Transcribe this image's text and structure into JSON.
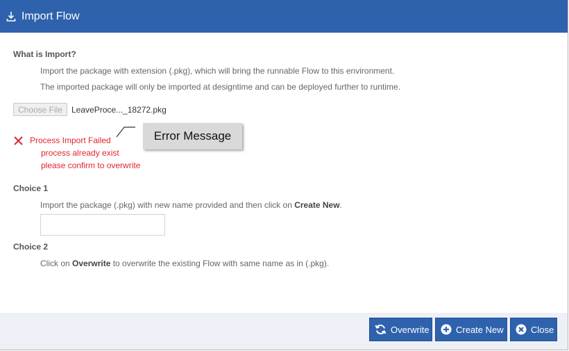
{
  "header": {
    "title": "Import Flow",
    "icon": "download-icon"
  },
  "what_is_import": {
    "heading": "What is Import?",
    "line1": "Import the package with extension (.pkg), which will bring the runnable Flow to this environment.",
    "line2": "The imported package will only be imported at designtime and can be deployed further to runtime."
  },
  "file": {
    "choose_label": "Choose File",
    "filename": "LeaveProce..._18272.pkg"
  },
  "error": {
    "title": "Process Import Failed",
    "line2": "process already exist",
    "line3": "please confirm to overwrite",
    "color": "#e0262c"
  },
  "callout": {
    "label": "Error Message"
  },
  "choice1": {
    "heading": "Choice 1",
    "text_before": "Import the package (.pkg) with new name provided and then click on ",
    "text_bold": "Create New",
    "text_after": ".",
    "input_value": ""
  },
  "choice2": {
    "heading": "Choice 2",
    "text_before": "Click on ",
    "text_bold": "Overwrite",
    "text_after": " to overwrite the existing Flow with same name as in (.pkg)."
  },
  "buttons": {
    "overwrite": "Overwrite",
    "create_new": "Create New",
    "close": "Close"
  },
  "colors": {
    "accent": "#2f62ad",
    "footer_bg": "#edf0f6"
  }
}
